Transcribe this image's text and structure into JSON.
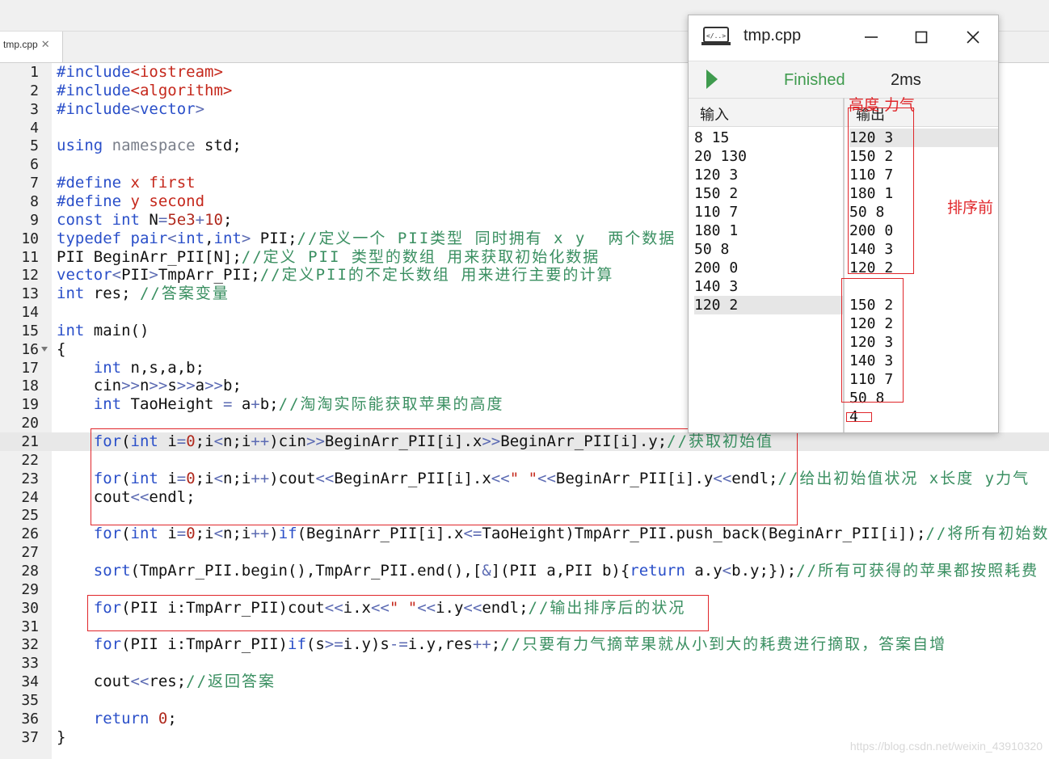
{
  "editor": {
    "tab_label": "tmp.cpp",
    "tab_close": "✕",
    "current_line": 21,
    "lines": [
      {
        "n": "1",
        "t": "#include<iostream>"
      },
      {
        "n": "2",
        "t": "#include<algorithm>"
      },
      {
        "n": "3",
        "t": "#include<vector>"
      },
      {
        "n": "4",
        "t": ""
      },
      {
        "n": "5",
        "t": "using namespace std;"
      },
      {
        "n": "6",
        "t": ""
      },
      {
        "n": "7",
        "t": "#define x first"
      },
      {
        "n": "8",
        "t": "#define y second"
      },
      {
        "n": "9",
        "t": "const int N=5e3+10;"
      },
      {
        "n": "10",
        "t": "typedef pair<int,int> PII;//定义一个 PII类型 同时拥有 x y  两个数据"
      },
      {
        "n": "11",
        "t": "PII BeginArr_PII[N];//定义 PII 类型的数组 用来获取初始化数据"
      },
      {
        "n": "12",
        "t": "vector<PII>TmpArr_PII;//定义PII的不定长数组 用来进行主要的计算"
      },
      {
        "n": "13",
        "t": "int res; //答案变量"
      },
      {
        "n": "14",
        "t": ""
      },
      {
        "n": "15",
        "t": "int main()"
      },
      {
        "n": "16",
        "t": "{"
      },
      {
        "n": "17",
        "t": "    int n,s,a,b;"
      },
      {
        "n": "18",
        "t": "    cin>>n>>s>>a>>b;"
      },
      {
        "n": "19",
        "t": "    int TaoHeight = a+b;//淘淘实际能获取苹果的高度"
      },
      {
        "n": "20",
        "t": ""
      },
      {
        "n": "21",
        "t": "    for(int i=0;i<n;i++)cin>>BeginArr_PII[i].x>>BeginArr_PII[i].y;//获取初始值"
      },
      {
        "n": "22",
        "t": ""
      },
      {
        "n": "23",
        "t": "    for(int i=0;i<n;i++)cout<<BeginArr_PII[i].x<<\" \"<<BeginArr_PII[i].y<<endl;//给出初始值状况 x长度 y力气"
      },
      {
        "n": "24",
        "t": "    cout<<endl;"
      },
      {
        "n": "25",
        "t": ""
      },
      {
        "n": "26",
        "t": "    for(int i=0;i<n;i++)if(BeginArr_PII[i].x<=TaoHeight)TmpArr_PII.push_back(BeginArr_PII[i]);//将所有初始数"
      },
      {
        "n": "27",
        "t": ""
      },
      {
        "n": "28",
        "t": "    sort(TmpArr_PII.begin(),TmpArr_PII.end(),[&](PII a,PII b){return a.y<b.y;});//所有可获得的苹果都按照耗费"
      },
      {
        "n": "29",
        "t": ""
      },
      {
        "n": "30",
        "t": "    for(PII i:TmpArr_PII)cout<<i.x<<\" \"<<i.y<<endl;//输出排序后的状况"
      },
      {
        "n": "31",
        "t": ""
      },
      {
        "n": "32",
        "t": "    for(PII i:TmpArr_PII)if(s>=i.y)s-=i.y,res++;//只要有力气摘苹果就从小到大的耗费进行摘取，答案自增"
      },
      {
        "n": "33",
        "t": ""
      },
      {
        "n": "34",
        "t": "    cout<<res;//返回答案"
      },
      {
        "n": "35",
        "t": ""
      },
      {
        "n": "36",
        "t": "    return 0;"
      },
      {
        "n": "37",
        "t": "}"
      }
    ]
  },
  "run_window": {
    "title": "tmp.cpp",
    "status": "Finished",
    "time": "2ms",
    "input_header": "输入",
    "output_header": "输出",
    "input_lines": [
      "8 15",
      "20 130",
      "120 3",
      "150 2",
      "110 7",
      "180 1",
      "50 8",
      "200 0",
      "140 3",
      "120 2"
    ],
    "output_lines": [
      "120 3",
      "150 2",
      "110 7",
      "180 1",
      "50 8",
      "200 0",
      "140 3",
      "120 2",
      "",
      "150 2",
      "120 2",
      "120 3",
      "140 3",
      "110 7",
      "50 8",
      "4"
    ]
  },
  "annotations": {
    "height_strength": "高度 力气",
    "before_sort": "排序前"
  },
  "watermark": "https://blog.csdn.net/weixin_43910320",
  "colors": {
    "keyword": "#2a4fc9",
    "string": "#c5281c",
    "comment": "#3a8f61",
    "finished": "#3f9b4e",
    "annotation": "#e0262a"
  }
}
